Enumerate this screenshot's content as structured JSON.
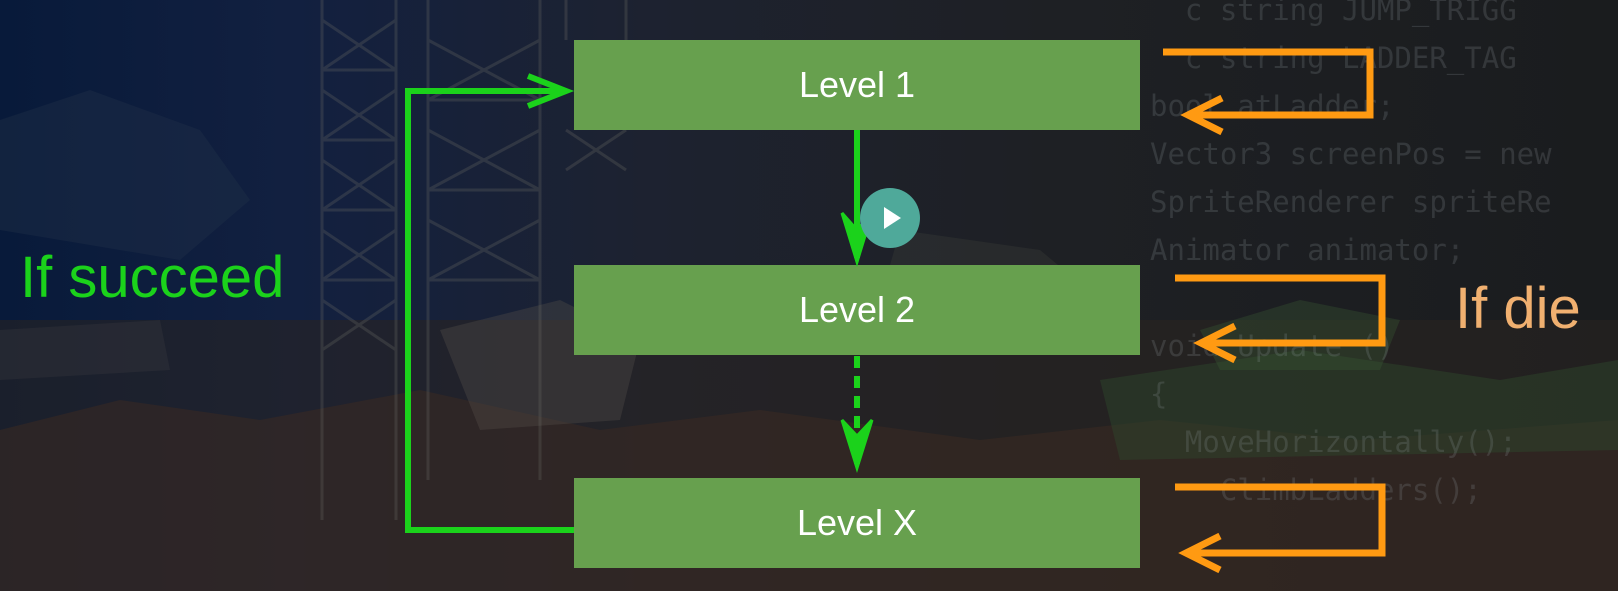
{
  "levels": [
    {
      "label": "Level 1"
    },
    {
      "label": "Level 2"
    },
    {
      "label": "Level X"
    }
  ],
  "labels": {
    "success": "If succeed",
    "death": "If die"
  },
  "icons": {
    "play": "play-icon"
  },
  "colors": {
    "box_fill": "#67a04e",
    "success_arrow": "#1bd21b",
    "death_arrow": "#ff9a12",
    "death_label": "#f0b070"
  }
}
